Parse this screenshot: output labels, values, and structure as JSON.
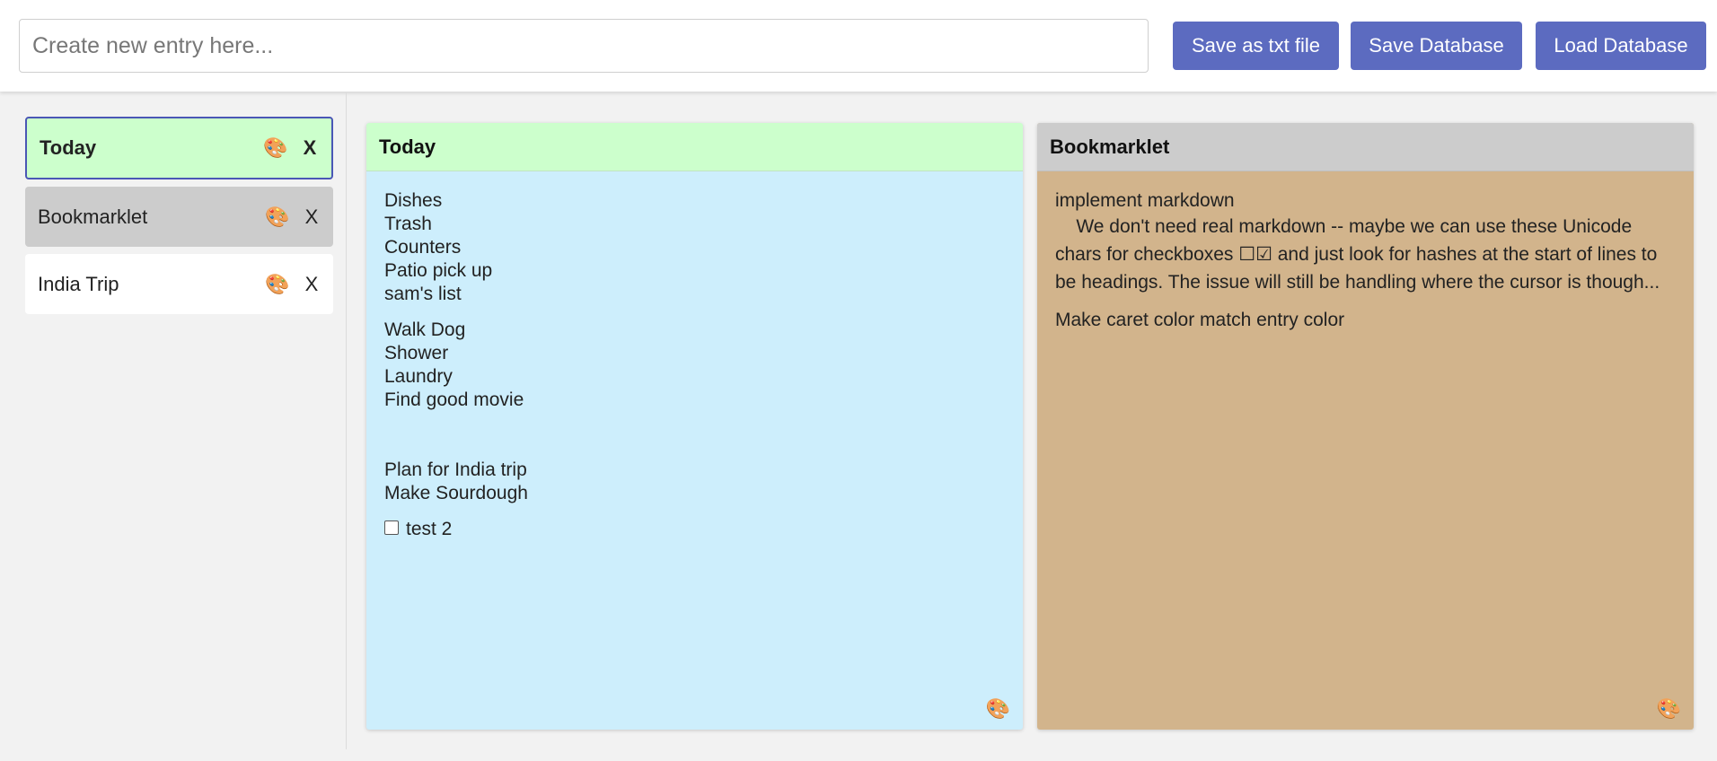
{
  "toolbar": {
    "new_entry_placeholder": "Create new entry here...",
    "save_txt_label": "Save as txt file",
    "save_db_label": "Save Database",
    "load_db_label": "Load Database",
    "button_color": "#5c6bc0"
  },
  "sidebar": {
    "items": [
      {
        "label": "Today",
        "palette_icon": "🎨",
        "close": "X",
        "color": "#ccffcc",
        "selected": true
      },
      {
        "label": "Bookmarklet",
        "palette_icon": "🎨",
        "close": "X",
        "color": "#cccccc",
        "selected": false
      },
      {
        "label": "India Trip",
        "palette_icon": "🎨",
        "close": "X",
        "color": "#ffffff",
        "selected": false
      }
    ]
  },
  "cards": [
    {
      "title": "Today",
      "header_color": "#ccffcc",
      "body_color": "#cdeefc",
      "palette_icon": "🎨",
      "lines": [
        "Dishes",
        "Trash",
        "Counters",
        "Patio pick up",
        "sam's list"
      ],
      "lines2": [
        "Walk Dog",
        "Shower",
        "Laundry",
        "Find good movie"
      ],
      "lines3": [
        "Plan for India trip",
        "Make Sourdough"
      ],
      "checkbox_item": "test 2"
    },
    {
      "title": "Bookmarklet",
      "header_color": "#cccccc",
      "body_color": "#d2b48c",
      "palette_icon": "🎨",
      "line1": "implement markdown",
      "para1": "    We don't need real markdown -- maybe we can use these Unicode chars for checkboxes ☐☑ and just look for hashes at the start of lines to be headings. The issue will still be handling where the cursor is though...",
      "line2": "Make caret color match entry color"
    }
  ]
}
